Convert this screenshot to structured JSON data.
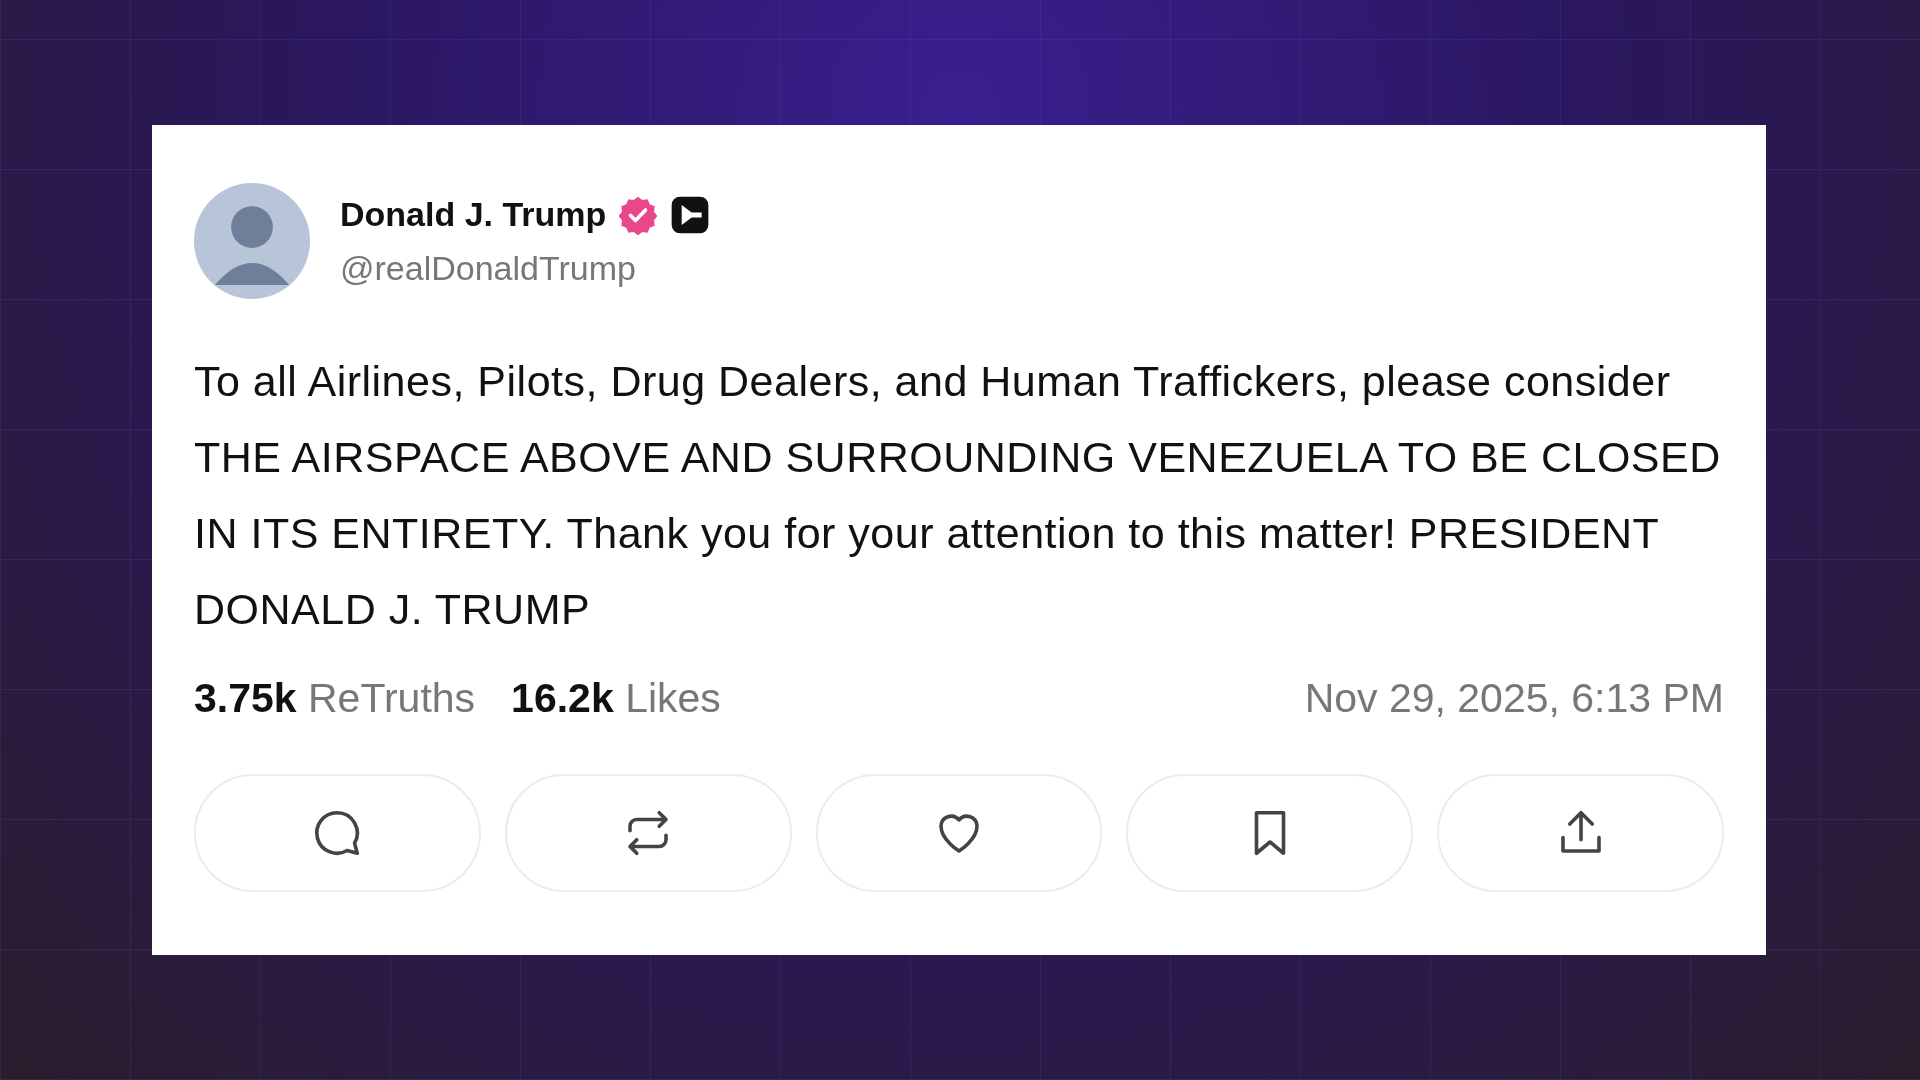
{
  "post": {
    "author": {
      "name": "Donald J. Trump",
      "handle": "@realDonaldTrump",
      "verified": true
    },
    "text": "To all Airlines, Pilots, Drug Dealers, and Human Traffickers, please consider THE AIRSPACE ABOVE AND SURROUNDING VENEZUELA TO BE CLOSED IN ITS ENTIRETY. Thank you for your attention to this matter! PRESIDENT DONALD J. TRUMP",
    "stats": [
      {
        "count": "3.75k",
        "label": "ReTruths"
      },
      {
        "count": "16.2k",
        "label": "Likes"
      }
    ],
    "timestamp": "Nov 29, 2025, 6:13 PM"
  }
}
